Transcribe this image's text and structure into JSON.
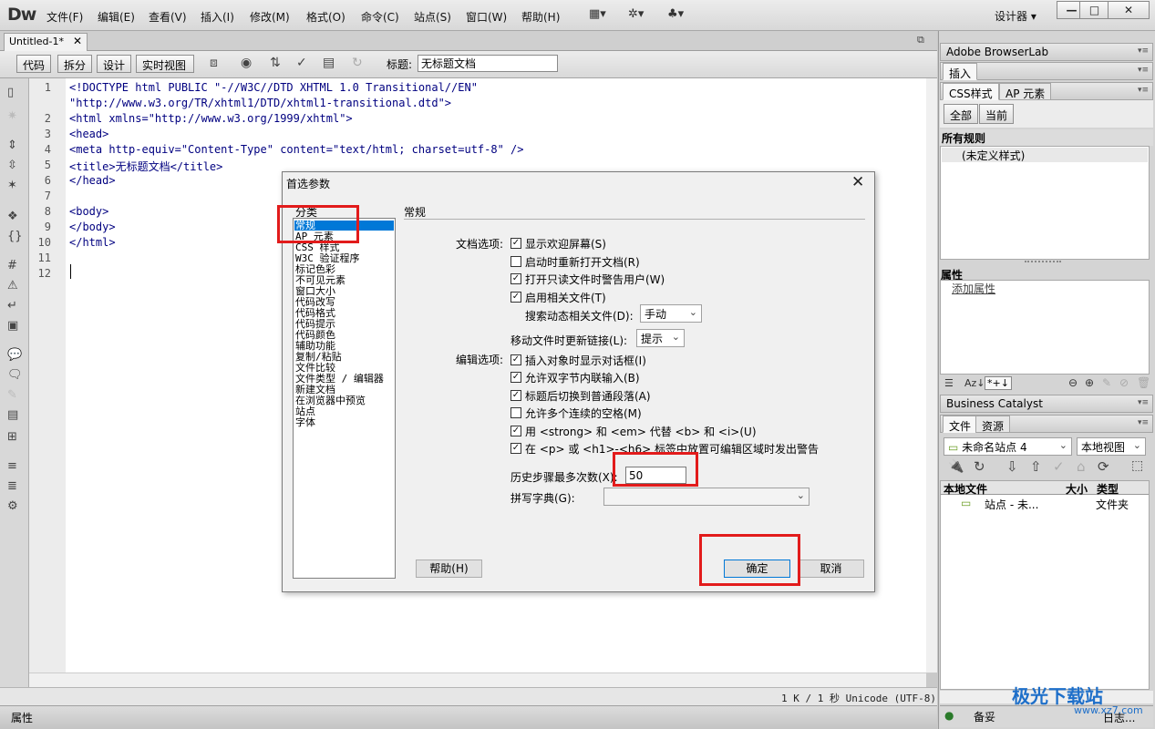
{
  "app": {
    "logo": "Dw",
    "menu": [
      "文件(F)",
      "编辑(E)",
      "查看(V)",
      "插入(I)",
      "修改(M)",
      "格式(O)",
      "命令(C)",
      "站点(S)",
      "窗口(W)",
      "帮助(H)"
    ],
    "workspace": "设计器 ▾",
    "window_buttons": [
      "—",
      "□",
      "✕"
    ]
  },
  "document": {
    "tab_name": "Untitled-1*",
    "view_buttons": [
      "代码",
      "拆分",
      "设计",
      "实时视图"
    ],
    "title_label": "标题:",
    "title_value": "无标题文档",
    "line_numbers": [
      "1",
      "",
      "2",
      "3",
      "4",
      "5",
      "6",
      "7",
      "8",
      "9",
      "10",
      "11",
      "12"
    ],
    "code_lines": [
      "<!DOCTYPE html PUBLIC \"-//W3C//DTD XHTML 1.0 Transitional//EN\"",
      "\"http://www.w3.org/TR/xhtml1/DTD/xhtml1-transitional.dtd\">",
      "<html xmlns=\"http://www.w3.org/1999/xhtml\">",
      "<head>",
      "<meta http-equiv=\"Content-Type\" content=\"text/html; charset=utf-8\" />",
      "<title>无标题文档</title>",
      "</head>",
      "",
      "<body>",
      "</body>",
      "</html>",
      "",
      ""
    ],
    "status": "1 K / 1 秒 Unicode (UTF-8)",
    "properties_label": "属性"
  },
  "right_panel": {
    "browserlab": "Adobe BrowserLab",
    "insert_tab": "插入",
    "css_tabs": [
      "CSS样式",
      "AP 元素"
    ],
    "css_buttons": [
      "全部",
      "当前"
    ],
    "all_rules_label": "所有规则",
    "rule_item": "(未定义样式)",
    "properties_title": "属性",
    "add_property": "添加属性",
    "business_catalyst": "Business Catalyst",
    "files_tabs": [
      "文件",
      "资源"
    ],
    "site_select": "未命名站点 4",
    "view_select": "本地视图",
    "file_columns": [
      "本地文件",
      "大小",
      "类型"
    ],
    "file_row": {
      "name": "站点 - 未...",
      "type": "文件夹"
    },
    "bottom_labels": [
      "备妥",
      "日志..."
    ]
  },
  "dialog": {
    "title": "首选参数",
    "category_label": "分类",
    "categories": [
      "常规",
      "AP 元素",
      "CSS 样式",
      "W3C 验证程序",
      "标记色彩",
      "不可见元素",
      "窗口大小",
      "代码改写",
      "代码格式",
      "代码提示",
      "代码颜色",
      "辅助功能",
      "复制/粘贴",
      "文件比较",
      "文件类型 / 编辑器",
      "新建文档",
      "在浏览器中预览",
      "站点",
      "字体"
    ],
    "section_title": "常规",
    "doc_options_label": "文档选项:",
    "doc_options": [
      {
        "label": "显示欢迎屏幕(S)",
        "checked": true
      },
      {
        "label": "启动时重新打开文档(R)",
        "checked": false
      },
      {
        "label": "打开只读文件时警告用户(W)",
        "checked": true
      },
      {
        "label": "启用相关文件(T)",
        "checked": true
      }
    ],
    "search_dynamic_label": "搜索动态相关文件(D):",
    "search_dynamic_value": "手动",
    "move_files_label": "移动文件时更新链接(L):",
    "move_files_value": "提示",
    "edit_options_label": "编辑选项:",
    "edit_options": [
      {
        "label": "插入对象时显示对话框(I)",
        "checked": true
      },
      {
        "label": "允许双字节内联输入(B)",
        "checked": true
      },
      {
        "label": "标题后切换到普通段落(A)",
        "checked": true
      },
      {
        "label": "允许多个连续的空格(M)",
        "checked": false
      },
      {
        "label": "用 <strong> 和 <em> 代替 <b> 和 <i>(U)",
        "checked": true
      },
      {
        "label": "在 <p> 或 <h1>-<h6> 标签中放置可编辑区域时发出警告",
        "checked": true
      }
    ],
    "history_label": "历史步骤最多次数(X):",
    "history_value": "50",
    "spell_label": "拼写字典(G):",
    "spell_value": "",
    "help_button": "帮助(H)",
    "ok_button": "确定",
    "cancel_button": "取消"
  },
  "watermark": {
    "text": "极光下载站",
    "url_text": "www.xz7.com"
  },
  "colors": {
    "highlight": "#e21b1b",
    "selection": "#0078d7",
    "code": "#000080"
  }
}
